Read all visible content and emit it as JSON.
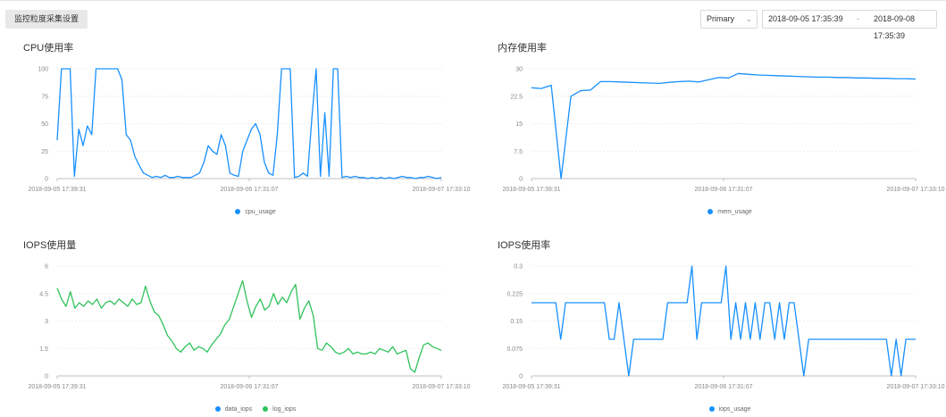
{
  "toolbar": {
    "settings_button": "监控粒度采集设置",
    "instance_select": "Primary",
    "range_start": "2018-09-05 17:35:39",
    "range_separator": "-",
    "range_end": "2018-09-08 17:35:39"
  },
  "colors": {
    "blue": "#1890ff",
    "green": "#2fc25b"
  },
  "chart_data": [
    {
      "id": "cpu",
      "type": "line",
      "title": "CPU使用率",
      "x_labels": [
        "2018-09-05 17:39:31",
        "2018-09-06 17:31:07",
        "2018-09-07 17:33:10"
      ],
      "y_ticks": [
        "0",
        "25",
        "50",
        "75",
        "100"
      ],
      "ylim": [
        0,
        100
      ],
      "x_points": 90,
      "series": [
        {
          "name": "cpu_usage",
          "color": "#1890ff",
          "values": [
            35,
            100,
            100,
            100,
            2,
            45,
            30,
            48,
            40,
            100,
            100,
            100,
            100,
            100,
            100,
            90,
            40,
            35,
            20,
            12,
            5,
            3,
            1,
            2,
            1,
            3,
            1,
            1,
            2,
            1,
            1,
            1,
            3,
            5,
            15,
            30,
            25,
            22,
            40,
            30,
            5,
            3,
            2,
            25,
            35,
            45,
            50,
            40,
            15,
            5,
            3,
            40,
            100,
            100,
            100,
            1,
            2,
            5,
            2,
            55,
            100,
            2,
            60,
            2,
            100,
            100,
            1,
            2,
            1,
            2,
            1,
            1,
            0,
            1,
            0,
            1,
            0,
            1,
            0,
            1,
            2,
            1,
            1,
            0,
            1,
            1,
            2,
            1,
            0,
            1
          ]
        }
      ]
    },
    {
      "id": "mem",
      "type": "line",
      "title": "内存使用率",
      "x_labels": [
        "2018-09-05 17:39:31",
        "2018-09-06 17:31:07",
        "2018-09-07 17:33:10"
      ],
      "y_ticks": [
        "0",
        "7.5",
        "15",
        "22.5",
        "30"
      ],
      "ylim": [
        0,
        30
      ],
      "x_points": 40,
      "series": [
        {
          "name": "mem_usage",
          "color": "#1890ff",
          "values": [
            24.8,
            24.6,
            25.5,
            0,
            22.5,
            24,
            24.2,
            26.5,
            26.5,
            26.4,
            26.3,
            26.2,
            26.1,
            26,
            26.3,
            26.5,
            26.6,
            26.4,
            27,
            27.6,
            27.5,
            28.7,
            28.5,
            28.3,
            28.2,
            28.1,
            28,
            27.9,
            27.8,
            27.7,
            27.7,
            27.6,
            27.6,
            27.5,
            27.5,
            27.4,
            27.4,
            27.3,
            27.3,
            27.2
          ]
        }
      ]
    },
    {
      "id": "iops",
      "type": "line",
      "title": "IOPS使用量",
      "x_labels": [
        "2018-09-05 17:39:31",
        "2018-09-06 17:31:07",
        "2018-09-07 17:33:10"
      ],
      "y_ticks": [
        "0",
        "1.5",
        "3",
        "4.5",
        "6"
      ],
      "ylim": [
        0,
        6
      ],
      "x_points": 88,
      "series": [
        {
          "name": "data_iops",
          "color": "#1890ff",
          "values": []
        },
        {
          "name": "log_iops",
          "color": "#2fc25b",
          "values": [
            4.8,
            4.2,
            3.8,
            4.6,
            3.7,
            4.0,
            3.8,
            4.1,
            3.9,
            4.2,
            3.7,
            4.0,
            4.1,
            3.9,
            4.2,
            4.0,
            3.8,
            4.2,
            3.9,
            4.0,
            4.9,
            4.1,
            3.5,
            3.3,
            2.8,
            2.2,
            1.9,
            1.5,
            1.3,
            1.6,
            1.8,
            1.4,
            1.6,
            1.5,
            1.3,
            1.7,
            2.0,
            2.3,
            2.8,
            3.1,
            3.8,
            4.5,
            5.2,
            4.1,
            3.2,
            3.8,
            4.2,
            3.6,
            3.8,
            4.5,
            3.9,
            4.3,
            4.0,
            4.6,
            5.0,
            3.1,
            3.7,
            4.1,
            3.3,
            1.5,
            1.4,
            1.8,
            1.6,
            1.3,
            1.2,
            1.3,
            1.5,
            1.2,
            1.3,
            1.2,
            1.2,
            1.3,
            1.2,
            1.5,
            1.4,
            1.3,
            1.6,
            1.2,
            1.3,
            1.4,
            0.4,
            0.2,
            1.0,
            1.7,
            1.8,
            1.6,
            1.5,
            1.4
          ]
        }
      ]
    },
    {
      "id": "iopsrate",
      "type": "line",
      "title": "IOPS使用率",
      "x_labels": [
        "2018-09-05 17:39:31",
        "2018-09-06 17:31:07",
        "2018-09-07 17:33:10"
      ],
      "y_ticks": [
        "0",
        "0.075",
        "0.15",
        "0.225",
        "0.3"
      ],
      "ylim": [
        0,
        0.3
      ],
      "x_points": 80,
      "series": [
        {
          "name": "iops_usage",
          "color": "#1890ff",
          "values": [
            0.2,
            0.2,
            0.2,
            0.2,
            0.2,
            0.2,
            0.1,
            0.2,
            0.2,
            0.2,
            0.2,
            0.2,
            0.2,
            0.2,
            0.2,
            0.2,
            0.1,
            0.1,
            0.2,
            0.1,
            0,
            0.1,
            0.1,
            0.1,
            0.1,
            0.1,
            0.1,
            0.1,
            0.2,
            0.2,
            0.2,
            0.2,
            0.2,
            0.3,
            0.1,
            0.2,
            0.2,
            0.2,
            0.2,
            0.2,
            0.3,
            0.1,
            0.2,
            0.1,
            0.2,
            0.1,
            0.2,
            0.1,
            0.2,
            0.2,
            0.1,
            0.2,
            0.1,
            0.2,
            0.2,
            0.1,
            0,
            0.1,
            0.1,
            0.1,
            0.1,
            0.1,
            0.1,
            0.1,
            0.1,
            0.1,
            0.1,
            0.1,
            0.1,
            0.1,
            0.1,
            0.1,
            0.1,
            0.1,
            0,
            0.1,
            0,
            0.1,
            0.1,
            0.1
          ]
        }
      ]
    }
  ]
}
